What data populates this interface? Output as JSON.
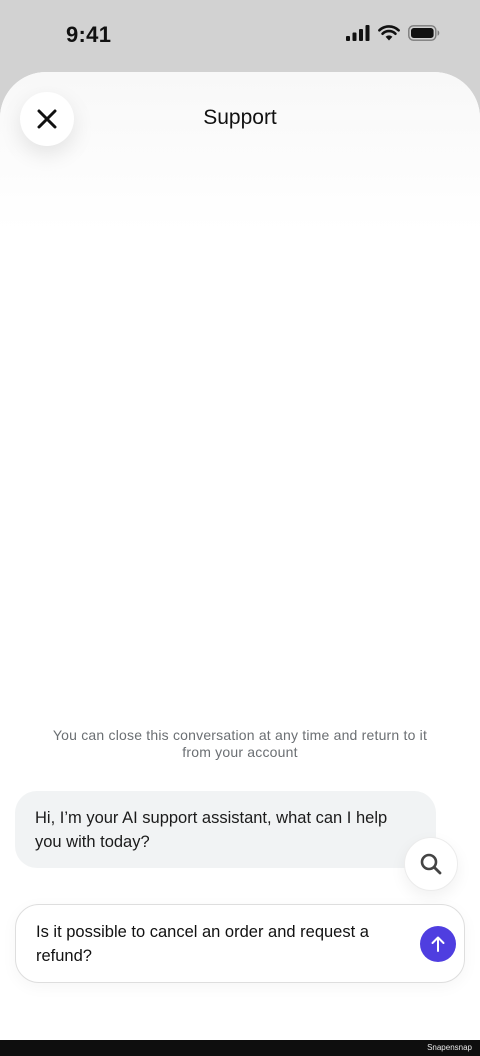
{
  "status_bar": {
    "time": "9:41"
  },
  "header": {
    "title": "Support"
  },
  "conversation": {
    "info_note": "You can close this conversation at any time and return to it from your account",
    "assistant_message": "Hi, I’m your AI support assistant, what can I help you with today?"
  },
  "composer": {
    "input_value": "Is it possible to cancel an order and request a refund?"
  },
  "footer": {
    "watermark": "Snapensnap"
  },
  "icons": {
    "close": "close-icon",
    "search": "search-icon",
    "send": "arrow-up-icon",
    "signal": "cellular-signal-icon",
    "wifi": "wifi-icon",
    "battery": "battery-icon"
  },
  "colors": {
    "accent": "#4f3ee0",
    "bubble": "#f1f3f4",
    "muted_text": "#6b6f73"
  }
}
